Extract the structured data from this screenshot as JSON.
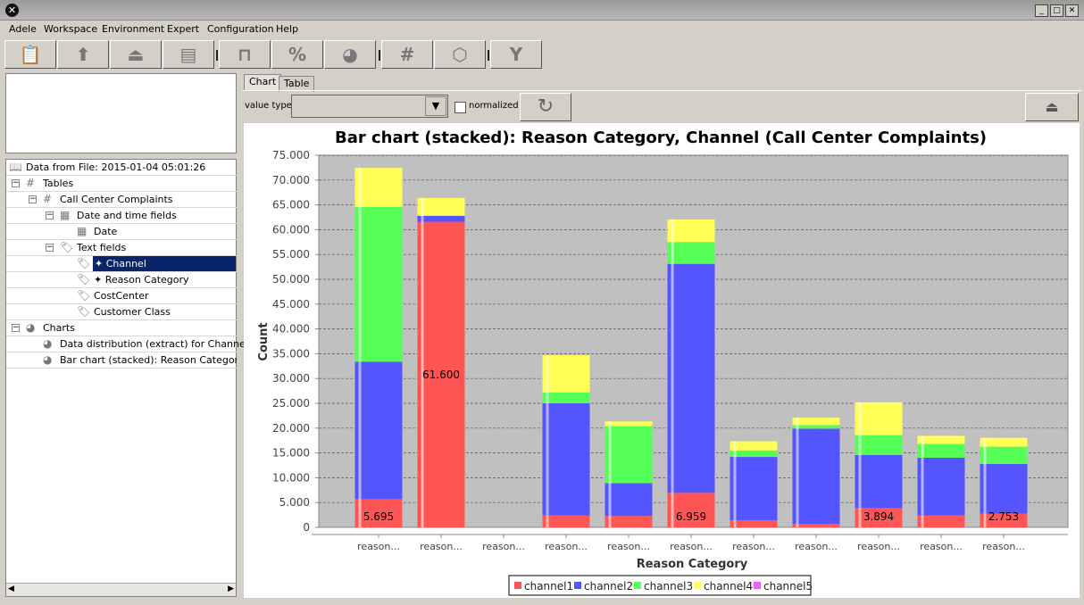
{
  "window": {
    "title": "",
    "app_icon": "app-x-icon",
    "controls": [
      "_",
      "□",
      "✕"
    ]
  },
  "menu": [
    "Adele",
    "Workspace",
    "Environment",
    "Expert",
    "Configuration",
    "Help"
  ],
  "toolbar": {
    "buttons": [
      {
        "icon": "clipboard-icon",
        "glyph": "📋"
      },
      {
        "icon": "upload-icon",
        "glyph": "⬆"
      },
      {
        "icon": "upload-drive-icon",
        "glyph": "⏏"
      },
      {
        "icon": "cabinet-icon",
        "glyph": "▤"
      },
      {
        "icon": "test-tube-icon",
        "glyph": "⊓"
      },
      {
        "icon": "percent-icon",
        "glyph": "%"
      },
      {
        "icon": "pie-chart-icon",
        "glyph": "◕"
      },
      {
        "icon": "grid-icon",
        "glyph": "#"
      },
      {
        "icon": "cube-icon",
        "glyph": "⬡"
      },
      {
        "icon": "filter-icon",
        "glyph": "Y"
      }
    ]
  },
  "tree": {
    "root": "Data from File: 2015-01-04 05:01:26",
    "tables": "Tables",
    "table": "Call Center Complaints",
    "date_group": "Date and time fields",
    "date": "Date",
    "text_group": "Text fields",
    "channel": "✦ Channel",
    "reason": "✦ Reason Category",
    "cost": "CostCenter",
    "customer": "Customer Class",
    "charts": "Charts",
    "chart1": "Data distribution (extract) for Channel",
    "chart2": "Bar chart (stacked): Reason Category, C",
    "selected": "Channel"
  },
  "tabs": [
    "Chart",
    "Table"
  ],
  "controls": {
    "value_type_label": "value type",
    "value_type_value": "",
    "normalized_label": "normalized",
    "normalized_checked": false
  },
  "chart_data": {
    "type": "bar",
    "stacked": true,
    "title": "Bar chart (stacked): Reason Category, Channel (Call Center Complaints)",
    "xlabel": "Reason Category",
    "ylabel": "Count",
    "ylim": [
      0,
      75000
    ],
    "yticks": [
      "0",
      "5.000",
      "10.000",
      "15.000",
      "20.000",
      "25.000",
      "30.000",
      "35.000",
      "40.000",
      "45.000",
      "50.000",
      "55.000",
      "60.000",
      "65.000",
      "70.000",
      "75.000"
    ],
    "grid": true,
    "legend_position": "bottom",
    "categories": [
      "reason...",
      "reason...",
      "reason...",
      "reason...",
      "reason...",
      "reason...",
      "reason...",
      "reason...",
      "reason...",
      "reason...",
      "reason..."
    ],
    "series": [
      {
        "name": "channel1",
        "color": "#ff5555",
        "values": [
          5695,
          61600,
          0,
          2400,
          2300,
          6959,
          1450,
          700,
          3894,
          2400,
          2753
        ]
      },
      {
        "name": "channel2",
        "color": "#5555ff",
        "values": [
          27700,
          1200,
          0,
          22600,
          6600,
          46150,
          12750,
          19200,
          10700,
          11650,
          10050
        ]
      },
      {
        "name": "channel3",
        "color": "#55ff55",
        "values": [
          31200,
          0,
          0,
          2200,
          11500,
          4400,
          1300,
          700,
          4000,
          2750,
          3450
        ]
      },
      {
        "name": "channel4",
        "color": "#ffff55",
        "values": [
          7850,
          3600,
          0,
          7500,
          950,
          4550,
          1850,
          1500,
          6600,
          1650,
          1800
        ]
      },
      {
        "name": "channel5",
        "color": "#ff55ff",
        "values": [
          0,
          0,
          0,
          0,
          0,
          0,
          0,
          0,
          0,
          0,
          0
        ]
      }
    ],
    "data_labels": [
      {
        "category": 0,
        "series": 0,
        "text": "5.695"
      },
      {
        "category": 1,
        "series": 0,
        "text": "61.600"
      },
      {
        "category": 5,
        "series": 0,
        "text": "6.959"
      },
      {
        "category": 8,
        "series": 0,
        "text": "3.894"
      },
      {
        "category": 10,
        "series": 0,
        "text": "2.753"
      }
    ]
  }
}
